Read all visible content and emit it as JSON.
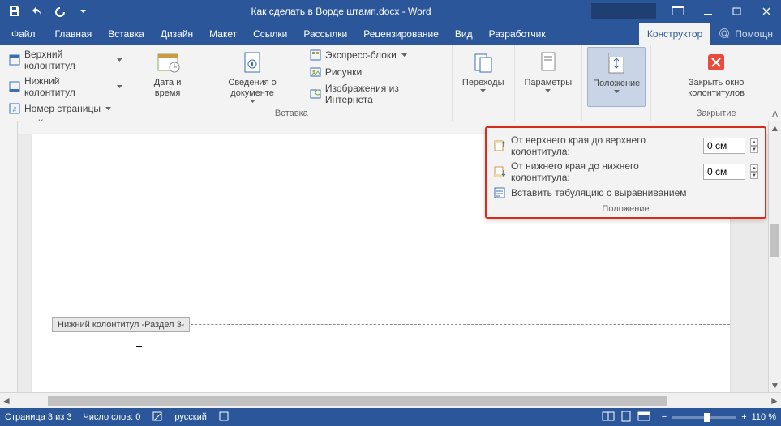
{
  "title": "Как сделать в Ворде штамп.docx - Word",
  "tabs": {
    "file": "Файл",
    "items": [
      "Главная",
      "Вставка",
      "Дизайн",
      "Макет",
      "Ссылки",
      "Рассылки",
      "Рецензирование",
      "Вид",
      "Разработчик"
    ],
    "context": "Конструктор",
    "tell": "Помощн"
  },
  "ribbon": {
    "g1": {
      "label": "Колонтитулы",
      "header": "Верхний колонтитул",
      "footer": "Нижний колонтитул",
      "pagenum": "Номер страницы"
    },
    "g2": {
      "label": "Вставка",
      "datetime": "Дата и время",
      "docinfo": "Сведения о документе",
      "quickparts": "Экспресс-блоки",
      "pictures": "Рисунки",
      "onlinepics": "Изображения из Интернета"
    },
    "g3": {
      "nav": "Переходы"
    },
    "g4": {
      "options": "Параметры"
    },
    "g5": {
      "position": "Положение"
    },
    "g6": {
      "label": "Закрытие",
      "close": "Закрыть окно колонтитулов"
    }
  },
  "popup": {
    "top_label": "От верхнего края до верхнего колонтитула:",
    "top_value": "0 ​см",
    "bottom_label": "От нижнего края до нижнего колонтитула:",
    "bottom_value": "0 см",
    "align_tab": "Вставить табуляцию с выравниванием",
    "group_label": "Положение"
  },
  "doc": {
    "footer_tag": "Нижний колонтитул -Раздел 3-"
  },
  "status": {
    "page": "Страница 3 из 3",
    "words": "Число слов: 0",
    "lang": "русский",
    "zoom": "110 %"
  }
}
